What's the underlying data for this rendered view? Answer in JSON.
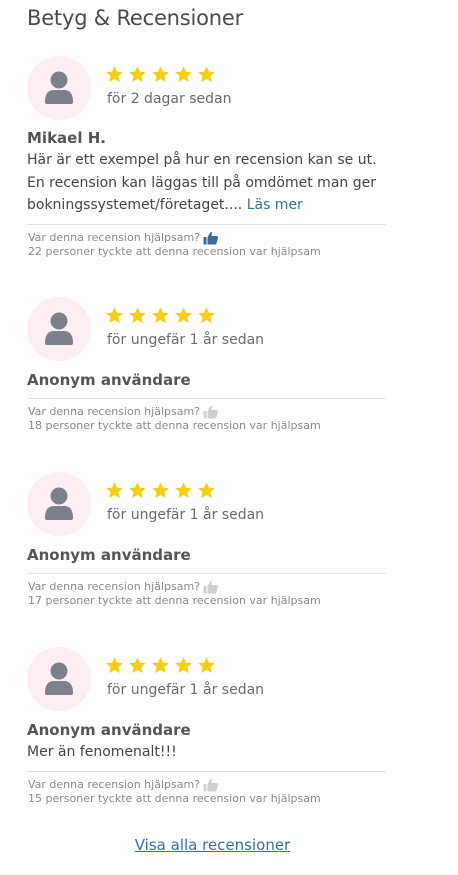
{
  "title": "Betyg & Recensioner",
  "colors": {
    "star": "#f6cf14",
    "avatar_bg": "#fdeef1",
    "avatar_figure": "#7c808a",
    "link": "#3b6e9a",
    "thumb_active": "#3d6a93",
    "thumb_inactive": "#cfcfcf"
  },
  "helpful_question": "Var denna recension hjälpsam?",
  "reviews": [
    {
      "rating": 5,
      "date": "för 2 dagar sedan",
      "author": "Mikael H.",
      "text": "Här är ett exempel på hur en recension kan se ut. En recension kan läggas till på omdömet man ger bokningssystemet/företaget....",
      "read_more": "Läs mer",
      "helpful_count_text": "22 personer tyckte att denna recension var hjälpsam",
      "thumb": "thumbs-up-icon-active"
    },
    {
      "rating": 5,
      "date": "för ungefär 1 år sedan",
      "author": "Anonym användare",
      "text": "",
      "helpful_count_text": "18 personer tyckte att denna recension var hjälpsam",
      "thumb": "thumbs-up-icon"
    },
    {
      "rating": 5,
      "date": "för ungefär 1 år sedan",
      "author": "Anonym användare",
      "text": "",
      "helpful_count_text": "17 personer tyckte att denna recension var hjälpsam",
      "thumb": "thumbs-up-icon"
    },
    {
      "rating": 5,
      "date": "för ungefär 1 år sedan",
      "author": "Anonym användare",
      "text": "Mer än fenomenalt!!!",
      "helpful_count_text": "15 personer tyckte att denna recension var hjälpsam",
      "thumb": "thumbs-up-icon"
    }
  ],
  "show_all_label": "Visa alla recensioner"
}
